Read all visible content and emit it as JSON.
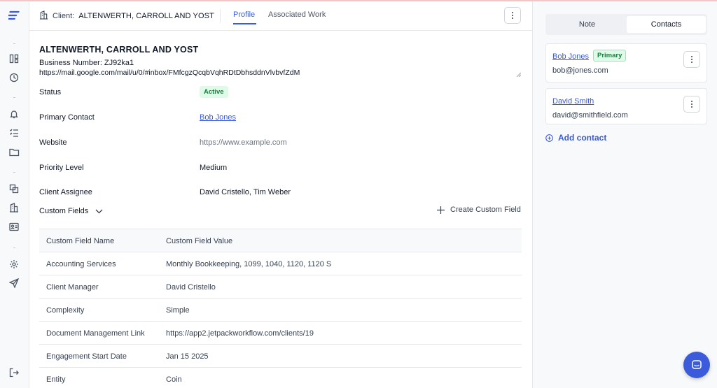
{
  "colors": {
    "accent": "#3b5bdb",
    "active_badge_bg": "#dcfce7",
    "active_badge_text": "#15803d"
  },
  "header": {
    "client_label": "Client:",
    "client_name": "ALTENWERTH, CARROLL AND YOST",
    "tabs": [
      {
        "label": "Profile",
        "active": true
      },
      {
        "label": "Associated Work",
        "active": false
      }
    ]
  },
  "profile": {
    "title": "ALTENWERTH, CARROLL AND YOST",
    "business_number": "Business Number: ZJ92ka1",
    "notes": "https://mail.google.com/mail/u/0/#inbox/FMfcgzQcqbVqhRDtDbhsddnVlvbvfZdM",
    "fields": {
      "status": {
        "label": "Status",
        "value": "Active"
      },
      "primary_contact": {
        "label": "Primary Contact",
        "value": "Bob Jones"
      },
      "website": {
        "label": "Website",
        "value": "https://www.example.com"
      },
      "priority_level": {
        "label": "Priority Level",
        "value": "Medium"
      },
      "client_assignee": {
        "label": "Client Assignee",
        "value": "David Cristello, Tim Weber"
      }
    }
  },
  "custom_fields": {
    "header_label": "Custom Fields",
    "create_label": "Create Custom Field",
    "columns": [
      "Custom Field Name",
      "Custom Field Value"
    ],
    "rows": [
      [
        "Accounting Services",
        "Monthly Bookkeeping, 1099, 1040, 1120, 1120 S"
      ],
      [
        "Client Manager",
        "David Cristello"
      ],
      [
        "Complexity",
        "Simple"
      ],
      [
        "Document Management Link",
        "https://app2.jetpackworkflow.com/clients/19"
      ],
      [
        "Engagement Start Date",
        "Jan 15 2025"
      ],
      [
        "Entity",
        "Coin"
      ]
    ]
  },
  "right_panel": {
    "tabs": [
      {
        "label": "Note",
        "active": false
      },
      {
        "label": "Contacts",
        "active": true
      }
    ],
    "contacts": [
      {
        "name": "Bob Jones",
        "email": "bob@jones.com",
        "badge": "Primary"
      },
      {
        "name": "David Smith",
        "email": "david@smithfield.com"
      }
    ],
    "add_contact_label": "Add contact"
  },
  "sidebar_icons": [
    "logo-icon",
    "board-icon",
    "dashboard-clock-icon",
    "bell-icon",
    "checklist-icon",
    "folder-icon",
    "copy-icon",
    "building-icon",
    "contact-card-icon",
    "gear-icon",
    "send-icon",
    "logout-icon"
  ]
}
